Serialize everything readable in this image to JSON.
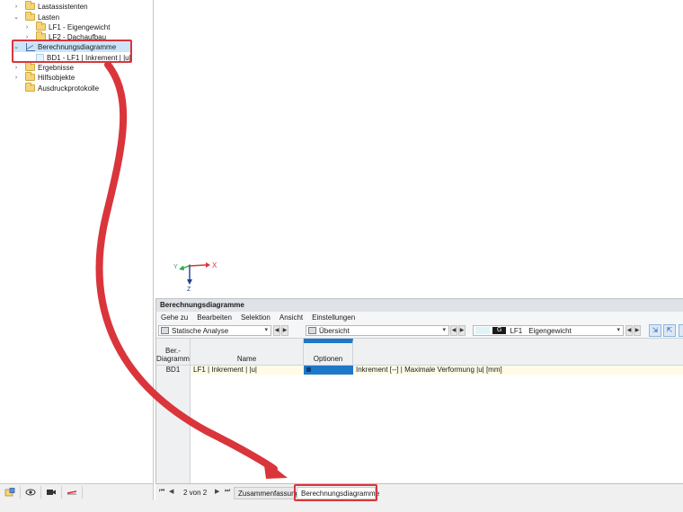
{
  "tree": {
    "items": [
      {
        "label": "Lastassistenten",
        "chevron": "›"
      },
      {
        "label": "Lasten",
        "chevron": "⌄"
      },
      {
        "label": "LF1 - Eigengewicht",
        "chevron": "›"
      },
      {
        "label": "LF2 - Dachaufbau",
        "chevron": "›"
      },
      {
        "label": "Berechnungsdiagramme",
        "chevron": "⌄"
      },
      {
        "label": "BD1 - LF1 | Inkrement | |u|",
        "chevron": ""
      },
      {
        "label": "Ergebnisse",
        "chevron": "›"
      },
      {
        "label": "Hilfsobjekte",
        "chevron": "›"
      },
      {
        "label": "Ausdruckprotokolle",
        "chevron": ""
      }
    ]
  },
  "axes": {
    "x": "X",
    "y": "Y",
    "z": "Z"
  },
  "panel": {
    "title": "Berechnungsdiagramme",
    "menu": [
      "Gehe zu",
      "Bearbeiten",
      "Selektion",
      "Ansicht",
      "Einstellungen"
    ],
    "toolbar": {
      "analysis": "Statische Analyse",
      "view": "Übersicht",
      "lc_badge": "G",
      "lc_id": "LF1",
      "lc_name": "Eigengewicht"
    },
    "table": {
      "headers": {
        "col1_line1": "Ber.-",
        "col1_line2": "Diagramm",
        "col2": "Name",
        "col3": "Optionen"
      },
      "rows": [
        {
          "id": "BD1",
          "name": "LF1 | Inkrement | |u|",
          "description": "Inkrement [--] | Maximale Verformung |u| [mm]"
        }
      ]
    }
  },
  "tabbar": {
    "page": "2 von 2",
    "tabs": [
      "Zusammenfassung",
      "Berechnungsdiagramme"
    ]
  },
  "colors": {
    "accent_red": "#d9353b",
    "selection": "#cce4f7",
    "options_blue": "#1e78c8"
  }
}
